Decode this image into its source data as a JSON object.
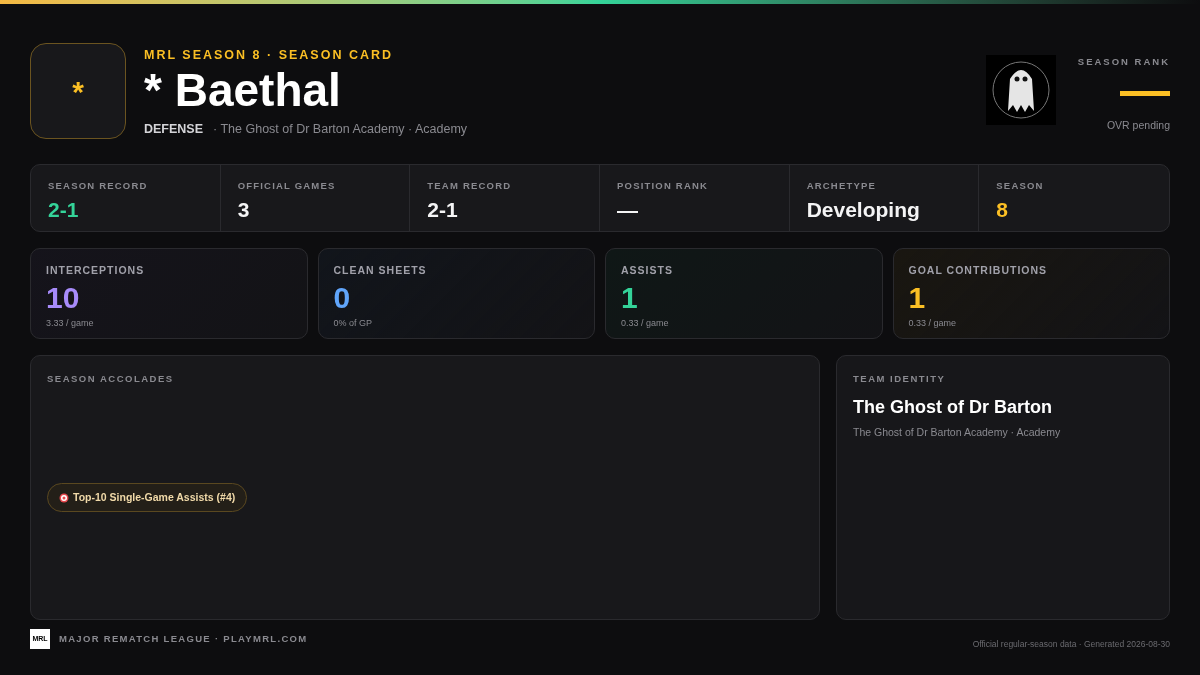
{
  "header": {
    "avatar_glyph": "*",
    "eyebrow": "MRL SEASON 8 · SEASON CARD",
    "player_name": "* Baethal",
    "position": "DEFENSE",
    "team_line": "· The Ghost of Dr Barton Academy · Academy"
  },
  "season_rank": {
    "label": "SEASON RANK",
    "note": "OVR pending"
  },
  "summary": [
    {
      "label": "SEASON RECORD",
      "value": "2-1",
      "color": "#34d399"
    },
    {
      "label": "OFFICIAL GAMES",
      "value": "3",
      "color": "#f4f4f5"
    },
    {
      "label": "TEAM RECORD",
      "value": "2-1",
      "color": "#f4f4f5"
    },
    {
      "label": "POSITION RANK",
      "value": "—",
      "color": "#f4f4f5"
    },
    {
      "label": "ARCHETYPE",
      "value": "Developing",
      "color": "#f4f4f5"
    },
    {
      "label": "SEASON",
      "value": "8",
      "color": "#fbbf24"
    }
  ],
  "highlights": [
    {
      "label": "INTERCEPTIONS",
      "value": "10",
      "sub": "3.33 / game",
      "color": "#a78bfa"
    },
    {
      "label": "CLEAN SHEETS",
      "value": "0",
      "sub": "0% of GP",
      "color": "#60a5fa"
    },
    {
      "label": "ASSISTS",
      "value": "1",
      "sub": "0.33 / game",
      "color": "#34d399"
    },
    {
      "label": "GOAL CONTRIBUTIONS",
      "value": "1",
      "sub": "0.33 / game",
      "color": "#fbbf24"
    }
  ],
  "accolades": {
    "title": "SEASON ACCOLADES",
    "items": [
      {
        "label": "Top-10 Single-Game Assists (#4)"
      }
    ]
  },
  "team_identity": {
    "title": "TEAM IDENTITY",
    "name": "The Ghost of Dr Barton",
    "sub": "The Ghost of Dr Barton Academy · Academy"
  },
  "footer": {
    "logo": "MRL",
    "brand": "MAJOR REMATCH LEAGUE · PLAYMRL.COM",
    "note": "Official regular-season data · Generated 2026-08-30"
  }
}
